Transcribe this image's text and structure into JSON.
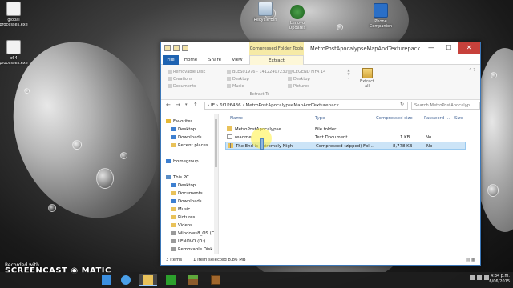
{
  "desktop": {
    "icons_left": [
      {
        "label": "global\nprocesses.exe",
        "icon": "application-icon"
      },
      {
        "label": "x64\nprocesses.exe",
        "icon": "application-icon"
      }
    ],
    "icons_top": [
      {
        "label": "Recycle Bin",
        "icon": "recycle-bin-icon"
      },
      {
        "label": "Lenovo\nUpdates",
        "icon": "lenovo-icon"
      },
      {
        "label": "Phone\nCompanion",
        "icon": "phone-icon"
      }
    ]
  },
  "window": {
    "title": "MetroPostApocalypseMapAndTexturepack",
    "contextual_tab": "Compressed Folder Tools",
    "tabs": {
      "file": "File",
      "home": "Home",
      "share": "Share",
      "view": "View",
      "extract": "Extract"
    },
    "controls": {
      "minimize": "—",
      "maximize": "☐",
      "close": "✕"
    },
    "ribbon": {
      "destinations": [
        [
          "Removable Disk",
          "Creations",
          "Documents"
        ],
        [
          "BLES01976 - 1412240723090",
          "Desktop",
          "Music"
        ],
        [
          "LEGEND FIFA 14",
          "Desktop",
          "Pictures"
        ]
      ],
      "group_label": "Extract To",
      "extract_all": "Extract\nall"
    },
    "address": {
      "back": "←",
      "forward": "→",
      "up": "↑",
      "path": "›  IE  ›  6f1P6436  ›  MetroPostApocalypseMapAndTexturepack",
      "refresh": "↻",
      "search_placeholder": "Search MetroPostApocalyp..."
    },
    "nav_pane": {
      "favorites": "Favorites",
      "favorites_items": [
        "Desktop",
        "Downloads",
        "Recent places"
      ],
      "homegroup": "Homegroup",
      "this_pc": "This PC",
      "pc_items": [
        "Desktop",
        "Documents",
        "Downloads",
        "Music",
        "Pictures",
        "Videos",
        "Windows8_OS (C",
        "LENOVO (D:)",
        "Removable Disk"
      ]
    },
    "columns": {
      "name": "Name",
      "type": "Type",
      "compressed_size": "Compressed size",
      "password": "Password ...",
      "size": "Size"
    },
    "files": [
      {
        "name": "MetroPostApocalypse",
        "type": "File folder",
        "compressed_size": "",
        "password": "",
        "icon": "folder-icon"
      },
      {
        "name": "readme",
        "type": "Text Document",
        "compressed_size": "1 KB",
        "password": "No",
        "icon": "text-file-icon"
      },
      {
        "name": "The End is Extremely Nigh",
        "type": "Compressed (zipped) Fol...",
        "compressed_size": "8,778 KB",
        "password": "No",
        "icon": "zip-folder-icon"
      }
    ],
    "status": {
      "items": "3 items",
      "selected": "1 item selected  8.86 MB"
    }
  },
  "watermark": {
    "recorded_with": "Recorded with",
    "brand": "SCREENCAST ◉ MATIC"
  },
  "taskbar": {
    "time": "4:34 p.m.",
    "date": "6/06/2015",
    "pinned": [
      "start-icon",
      "ie-icon",
      "file-explorer-icon",
      "store-icon",
      "minecraft-icon",
      "chest-icon"
    ]
  }
}
